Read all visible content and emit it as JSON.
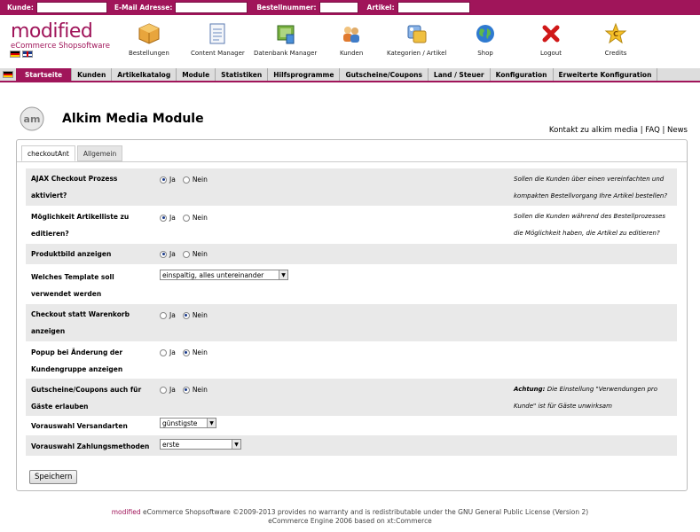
{
  "topbar": {
    "fields": [
      {
        "label": "Kunde:"
      },
      {
        "label": "E-Mail Adresse:"
      },
      {
        "label": "Bestellnummer:"
      },
      {
        "label": "Artikel:"
      }
    ]
  },
  "logo": {
    "word": "modified",
    "sub": "eCommerce Shopsoftware"
  },
  "nav_icons": [
    {
      "label": "Bestellungen",
      "icon": "box-icon"
    },
    {
      "label": "Content Manager",
      "icon": "document-icon"
    },
    {
      "label": "Datenbank Manager",
      "icon": "database-icon"
    },
    {
      "label": "Kunden",
      "icon": "users-icon"
    },
    {
      "label": "Kategorien / Artikel",
      "icon": "categories-icon"
    },
    {
      "label": "Shop",
      "icon": "globe-icon"
    },
    {
      "label": "Logout",
      "icon": "close-icon"
    },
    {
      "label": "Credits",
      "icon": "star-icon"
    }
  ],
  "menu": [
    {
      "label": "Startseite",
      "active": true
    },
    {
      "label": "Kunden"
    },
    {
      "label": "Artikelkatalog"
    },
    {
      "label": "Module"
    },
    {
      "label": "Statistiken"
    },
    {
      "label": "Hilfsprogramme"
    },
    {
      "label": "Gutscheine/Coupons"
    },
    {
      "label": "Land / Steuer"
    },
    {
      "label": "Konfiguration"
    },
    {
      "label": "Erweiterte Konfiguration"
    }
  ],
  "page": {
    "title": "Alkim Media Module",
    "links": "Kontakt zu alkim media | FAQ | News"
  },
  "tabs": [
    "checkoutAnt",
    "Allgemein"
  ],
  "radio_labels": {
    "yes": "Ja",
    "no": "Nein"
  },
  "rows": [
    {
      "label": "AJAX Checkout Prozess aktiviert?",
      "value": "Ja",
      "desc": "Sollen die Kunden über einen vereinfachten und kompakten Bestellvorgang Ihre Artikel bestellen?"
    },
    {
      "label": "Möglichkeit Artikelliste zu editieren?",
      "value": "Ja",
      "desc": "Sollen die Kunden während des Bestellprozesses die Möglichkeit haben, die Artikel zu editieren?"
    },
    {
      "label": "Produktbild anzeigen",
      "value": "Ja",
      "desc": ""
    },
    {
      "label": "Welches Template soll verwendet werden",
      "select": "einspaltig, alles untereinander",
      "desc": ""
    },
    {
      "label": "Checkout statt Warenkorb anzeigen",
      "value": "Nein",
      "desc": ""
    },
    {
      "label": "Popup bei Änderung der Kundengruppe anzeigen",
      "value": "Nein",
      "desc": ""
    },
    {
      "label": "Gutscheine/Coupons auch für Gäste erlauben",
      "value": "Nein",
      "desc_bold": "Achtung:",
      "desc": "Die Einstellung \"Verwendungen pro Kunde\" ist für Gäste unwirksam"
    },
    {
      "label": "Vorauswahl Versandarten",
      "select": "günstigste",
      "desc": ""
    },
    {
      "label": "Vorauswahl Zahlungsmethoden",
      "select": "erste",
      "desc": ""
    }
  ],
  "save_label": "Speichern",
  "footer": {
    "brand": "modified",
    "line1": "eCommerce Shopsoftware ©2009-2013 provides no warranty and is redistributable under the GNU General Public License (Version 2)",
    "line2": "eCommerce Engine 2006 based on xt:Commerce"
  }
}
